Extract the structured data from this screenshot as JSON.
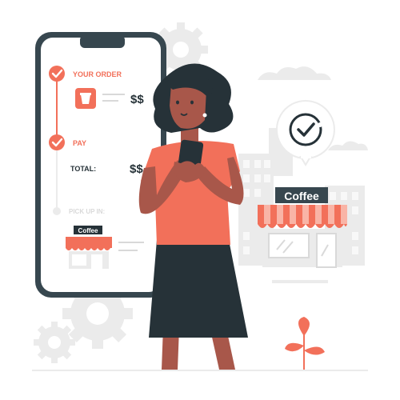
{
  "phone": {
    "steps": [
      {
        "label": "YOUR ORDER",
        "status": "done"
      },
      {
        "label": "PAY",
        "status": "done"
      },
      {
        "label": "PICK UP IN:",
        "status": "pending"
      }
    ],
    "order_price": "$$",
    "total_label": "TOTAL:",
    "total_price": "$$",
    "shop_sign": "Coffee"
  },
  "storefront": {
    "sign": "Coffee"
  },
  "icons": {
    "step_done": "check-circle-icon",
    "cup": "coffee-cup-icon",
    "status_bubble": "check-badge-icon",
    "gear": "gear-icon",
    "plant": "plant-icon"
  },
  "colors": {
    "accent": "#F2705A",
    "accent_light": "#F9B4A6",
    "dark": "#263238",
    "gray_light": "#EBEBEB",
    "gray_mid": "#D9D9D9",
    "skin": "#A8574A",
    "hair": "#263238",
    "phone_frame": "#37474F"
  }
}
